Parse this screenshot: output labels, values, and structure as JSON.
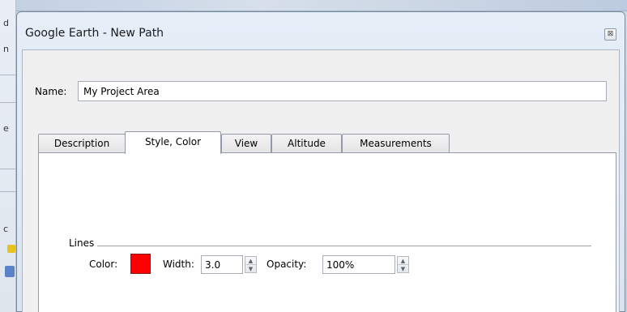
{
  "window": {
    "title": "Google Earth - New Path",
    "close_glyph": "⊠"
  },
  "form": {
    "name_label": "Name:",
    "name_value": "My Project Area"
  },
  "tabs": [
    {
      "label": "Description",
      "active": false
    },
    {
      "label": "Style, Color",
      "active": true
    },
    {
      "label": "View",
      "active": false
    },
    {
      "label": "Altitude",
      "active": false
    },
    {
      "label": "Measurements",
      "active": false
    }
  ],
  "lines": {
    "group_label": "Lines",
    "color_label": "Color:",
    "color_value": "#ff0000",
    "width_label": "Width:",
    "width_value": "3.0",
    "opacity_label": "Opacity:",
    "opacity_value": "100%"
  },
  "icons": {
    "spin_up": "▲",
    "spin_down": "▼"
  },
  "background": {
    "fragments": [
      "d",
      "n",
      "e",
      "c"
    ]
  }
}
